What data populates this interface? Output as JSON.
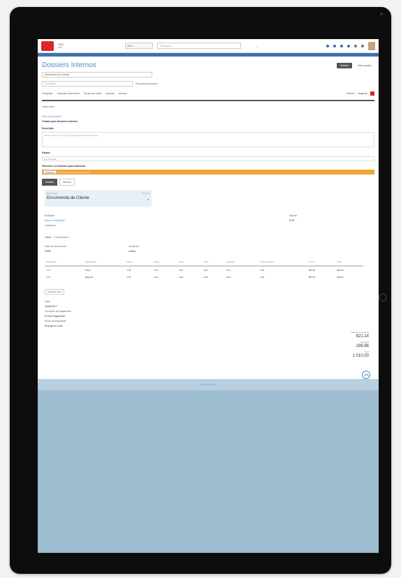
{
  "page": {
    "title": "Dossiers Internos",
    "top_select": "Documento de Cliente",
    "search_placeholder": "Pesquisa"
  },
  "topbar": {
    "select_label": "Alt+1",
    "search_placeholder": "Pesquisa"
  },
  "title_actions": {
    "primary": "Anterior",
    "secondary": "Mais opções"
  },
  "filter_row": {
    "input_placeholder": "Pesquisar",
    "action": "Pesquisa avançada"
  },
  "toolbar": {
    "items": [
      "Pesquisar",
      "Cancelar documento",
      "Enviar por email",
      "Imprimir",
      "Anexos"
    ],
    "right_items": [
      "Anterior",
      "Seguinte"
    ]
  },
  "section": {
    "back_link": "Voltar atrás",
    "config_link": "Série de Dossiers",
    "config_title": "Criador para Dossiers Internos",
    "desc_label": "Descrição",
    "desc_text": "Acesso direto ao documento gerado a partir deste dossier",
    "state_label": "Estado",
    "state_value": "Em execução",
    "docs_label": "Selecione os Dossiers para adicionar",
    "orange_btn": "Adicionar",
    "orange_text": "Adicionar documentos ao dossier"
  },
  "tabs": [
    "Detalhe",
    "Anexos"
  ],
  "card": {
    "label": "Documento",
    "value": "Encomenda de Cliente",
    "right_label": "Número"
  },
  "details": {
    "entidade_label": "Entidade",
    "entidade_value": "Nome da Entidade",
    "moeda_label": "Moeda",
    "moeda_value": "EUR",
    "contacts_label": "Contactos",
    "contacts_value": "Geral",
    "contacts_link": "Contabilidade",
    "data_label": "Data do documento",
    "data_value": "25/06",
    "vend_label": "Vendedor",
    "vend_value": "Lisboa"
  },
  "table": {
    "headers": [
      "Referência",
      "Designação",
      "Quant.",
      "Preço",
      "Desc.",
      "Valor",
      "Impostos",
      "Preço Unitário",
      "P. Unit.",
      "Total"
    ],
    "rows": [
      [
        "A001",
        "Artigo",
        "1,00",
        "0,00",
        "0,00",
        "0,00",
        "0,00",
        "0,00",
        "800,00",
        "800,00"
      ],
      [
        "B002",
        "Máquina",
        "1,00",
        "0,00",
        "0,00",
        "0,00",
        "0,00",
        "0,00",
        "800,00",
        "800,00"
      ]
    ],
    "add_row": "Adicionar linha"
  },
  "below_table": {
    "data_label": "Data",
    "data_value": "25/06/2017",
    "cond_label": "Condição de pagamento",
    "cond_value": "Pronto Pagamento",
    "modo_label": "Modo de expedição",
    "modo_value": "Entrega no local"
  },
  "totals": {
    "l1": "Total sem impostos",
    "v1": "821,14",
    "l2": "Impostos",
    "v2": "188,86",
    "l3": "Total",
    "v3": "1.010,00"
  },
  "footer": {
    "text": "Powered by PHC"
  },
  "colors": {
    "accent": "#4b8ec9",
    "brand": "#d9272e",
    "warning": "#f0a43a"
  }
}
